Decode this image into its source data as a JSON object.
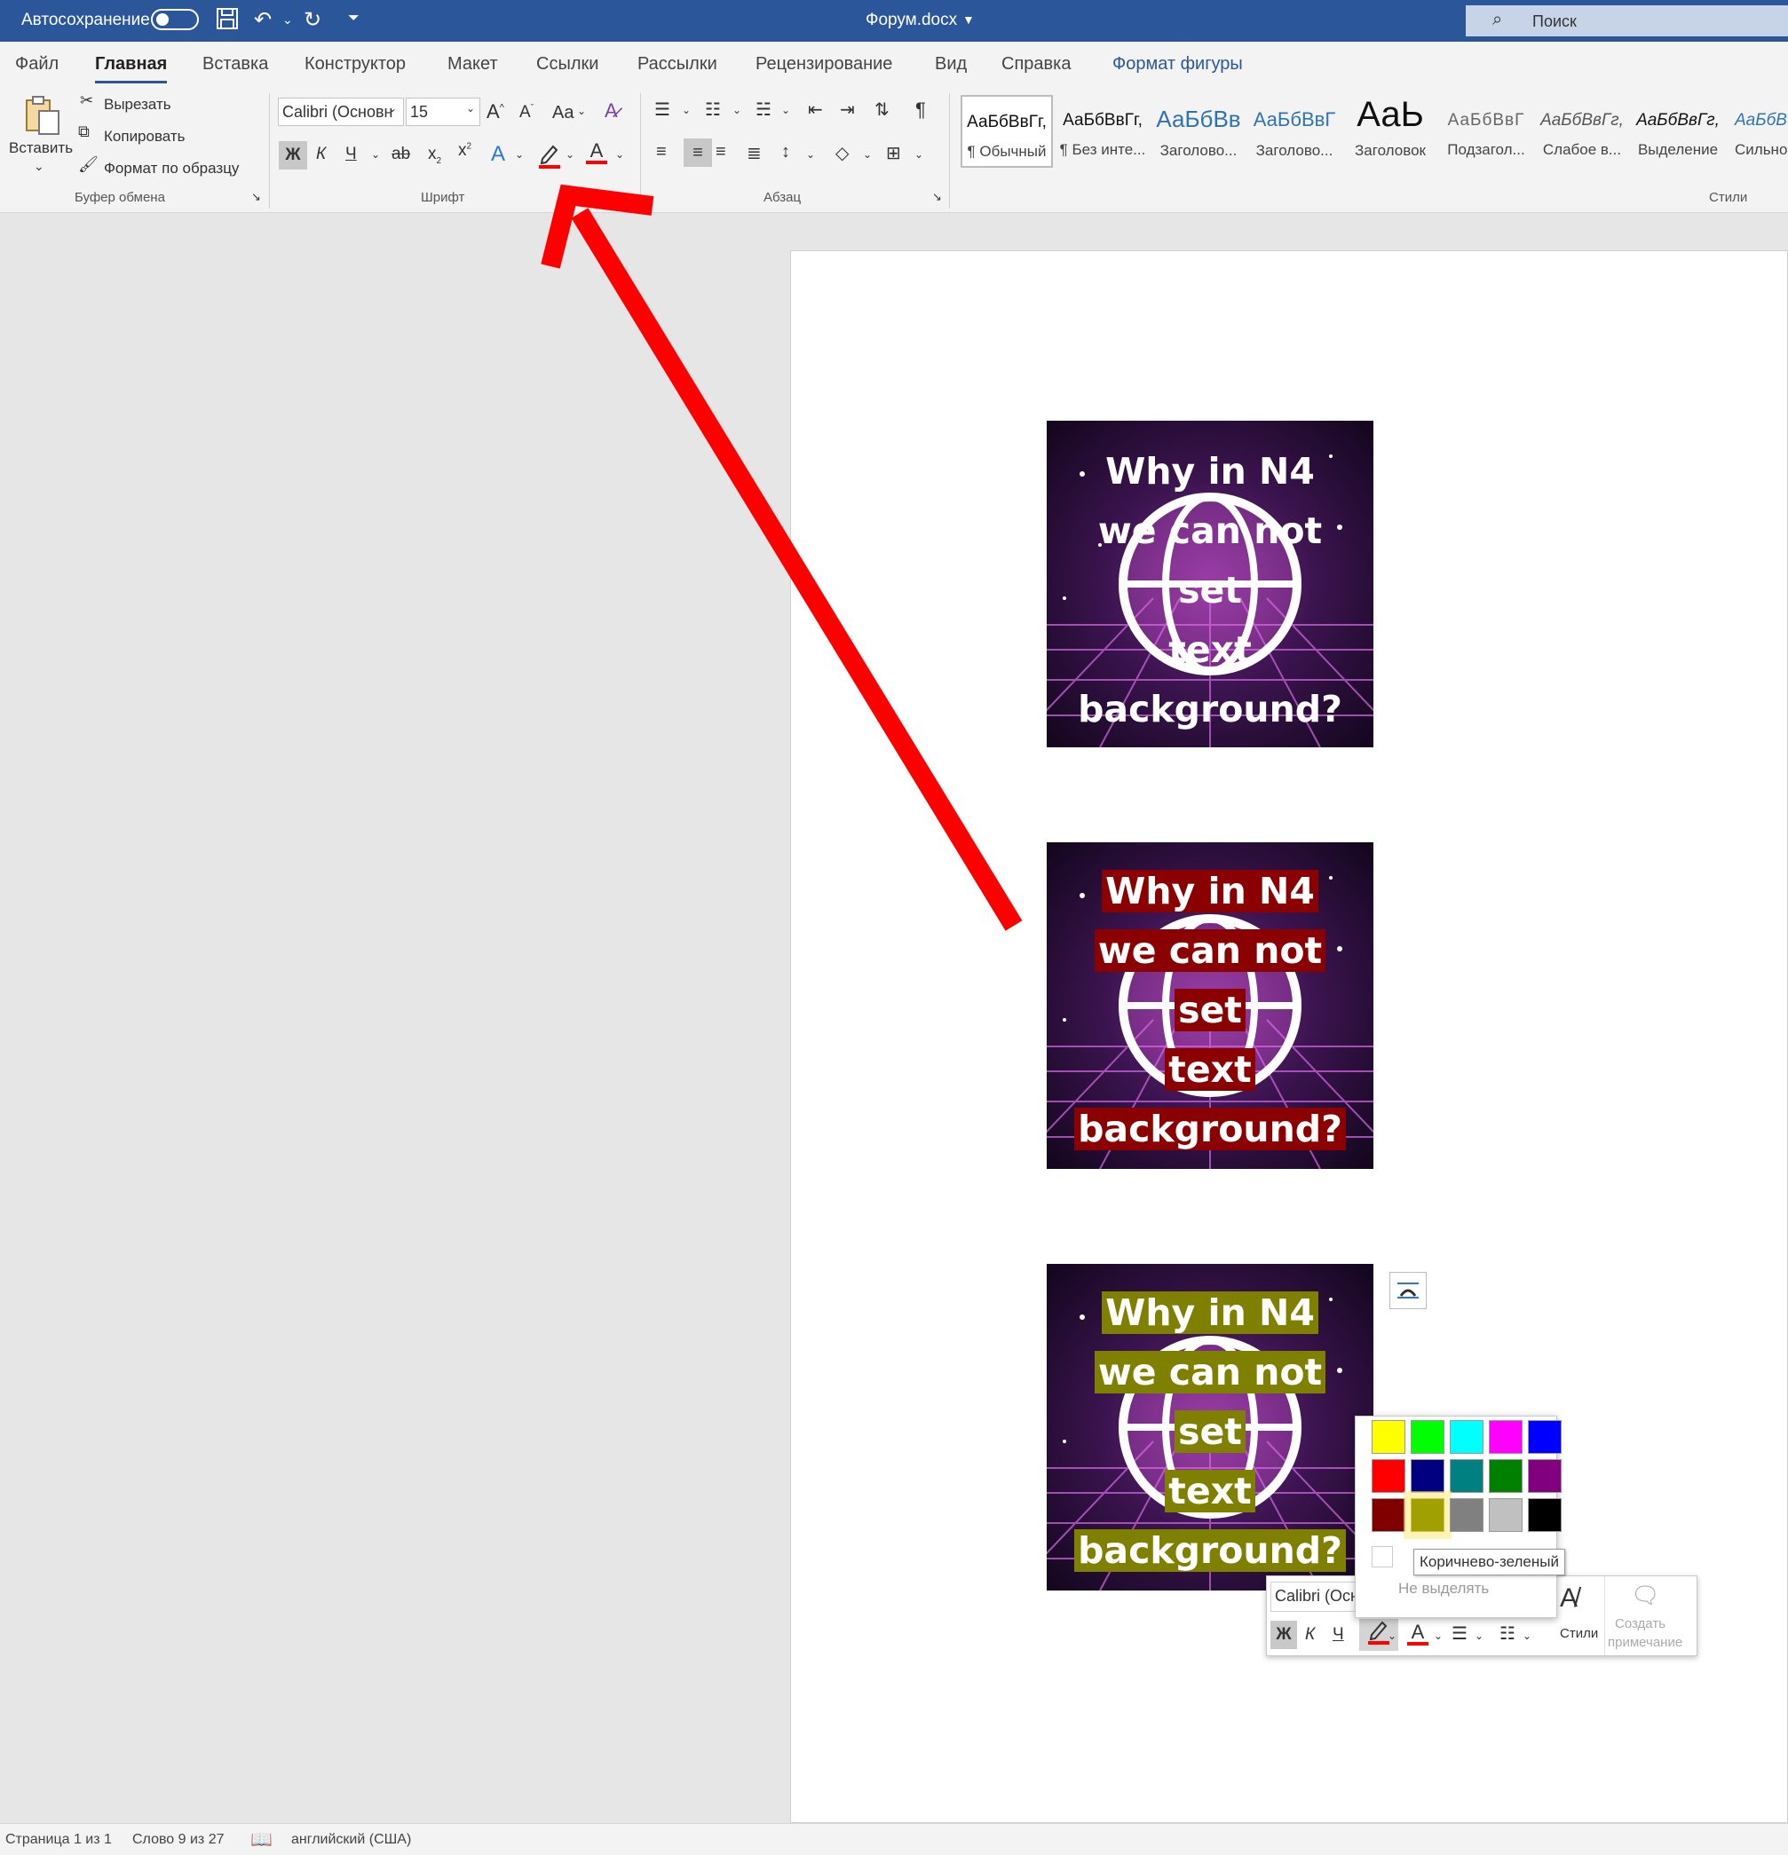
{
  "titlebar": {
    "autosave_label": "Автосохранение",
    "doc_title": "Форум.docx",
    "search_placeholder": "Поиск"
  },
  "menu": {
    "tabs": [
      "Файл",
      "Главная",
      "Вставка",
      "Конструктор",
      "Макет",
      "Ссылки",
      "Рассылки",
      "Рецензирование",
      "Вид",
      "Справка",
      "Формат фигуры"
    ],
    "active_tab": "Главная",
    "context_tab_color": "#2b579a"
  },
  "ribbon": {
    "clipboard": {
      "paste_label": "Вставить",
      "cut_label": "Вырезать",
      "copy_label": "Копировать",
      "format_painter_label": "Формат по образцу",
      "group_label": "Буфер обмена"
    },
    "font": {
      "font_name": "Calibri (Основн",
      "font_size": "15",
      "bold_label": "Ж",
      "italic_label": "К",
      "underline_label": "Ч",
      "strike_label": "ab",
      "sub_label": "x",
      "sup_label": "x",
      "change_case_label": "Aa",
      "group_label": "Шрифт",
      "highlight_color": "#ff0000",
      "font_color": "#ff0000"
    },
    "paragraph": {
      "group_label": "Абзац",
      "pilcrow": "¶"
    },
    "styles": {
      "group_label": "Стили",
      "items": [
        {
          "sample": "АаБбВвГг,",
          "name": "¶ Обычный"
        },
        {
          "sample": "АаБбВвГг,",
          "name": "¶ Без инте..."
        },
        {
          "sample": "АаБбВв",
          "name": "Заголово..."
        },
        {
          "sample": "АаБбВвГ",
          "name": "Заголово..."
        },
        {
          "sample": "АаЬ",
          "name": "Заголовок"
        },
        {
          "sample": "АаБбВвГ",
          "name": "Подзагол..."
        },
        {
          "sample": "АаБбВвГг,",
          "name": "Слабое в..."
        },
        {
          "sample": "АаБбВвГг,",
          "name": "Выделение"
        },
        {
          "sample": "АаБбВ",
          "name": "Сильно"
        }
      ]
    }
  },
  "document": {
    "images": [
      {
        "lines": [
          "Why in N4",
          "we can not",
          "set",
          "text",
          "background?"
        ],
        "highlight": "none"
      },
      {
        "lines": [
          "Why in N4",
          "we can not",
          "set",
          "text",
          "background?"
        ],
        "highlight": "#8b0000"
      },
      {
        "lines": [
          "Why in N4",
          "we can not",
          "set",
          "text",
          "background?"
        ],
        "highlight": "#7f7f00"
      }
    ]
  },
  "mini_toolbar": {
    "font_name": "Calibri (Осн",
    "bold_label": "Ж",
    "italic_label": "К",
    "underline_label": "Ч",
    "styles_label": "Стили",
    "comment_line1": "Создать",
    "comment_line2": "примечание"
  },
  "highlight_palette": {
    "colors": [
      "#ffff00",
      "#00ff00",
      "#00ffff",
      "#ff00ff",
      "#0000ff",
      "#ff0000",
      "#000080",
      "#008080",
      "#008000",
      "#800080",
      "#800000",
      "#a0a000",
      "#808080",
      "#c0c0c0",
      "#000000"
    ],
    "hovered_index": 11,
    "no_color_label": "Не выделять",
    "tooltip": "Коричнево-зеленый"
  },
  "statusbar": {
    "page": "Страница 1 из 1",
    "words": "Слово 9 из 27",
    "language": "английский (США)"
  },
  "annotation": {
    "arrow_color": "#ff0000"
  }
}
